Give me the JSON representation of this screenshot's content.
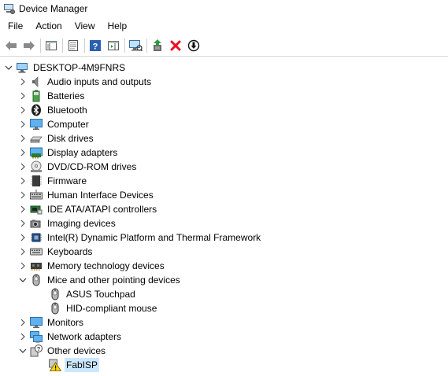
{
  "window": {
    "title": "Device Manager"
  },
  "menu": [
    "File",
    "Action",
    "View",
    "Help"
  ],
  "toolbar": {
    "buttons": [
      "back-arrow-icon",
      "forward-arrow-icon",
      "sep",
      "show-hide-tree-icon",
      "sep",
      "properties-icon",
      "sep",
      "help-icon",
      "action-pane-icon",
      "sep",
      "monitor-scan-icon",
      "sep",
      "update-driver-icon",
      "uninstall-icon",
      "disable-device-icon"
    ]
  },
  "tree": {
    "root": {
      "label": "DESKTOP-4M9FNRS",
      "expanded": true,
      "icon": "computer-root-icon"
    },
    "nodes": [
      {
        "label": "Audio inputs and outputs",
        "icon": "speaker-icon",
        "expanded": false
      },
      {
        "label": "Batteries",
        "icon": "battery-icon",
        "expanded": false
      },
      {
        "label": "Bluetooth",
        "icon": "bluetooth-icon",
        "expanded": false
      },
      {
        "label": "Computer",
        "icon": "monitor-icon",
        "expanded": false
      },
      {
        "label": "Disk drives",
        "icon": "disk-drive-icon",
        "expanded": false
      },
      {
        "label": "Display adapters",
        "icon": "display-adapter-icon",
        "expanded": false
      },
      {
        "label": "DVD/CD-ROM drives",
        "icon": "dvd-icon",
        "expanded": false
      },
      {
        "label": "Firmware",
        "icon": "firmware-icon",
        "expanded": false
      },
      {
        "label": "Human Interface Devices",
        "icon": "hid-icon",
        "expanded": false
      },
      {
        "label": "IDE ATA/ATAPI controllers",
        "icon": "ide-controller-icon",
        "expanded": false
      },
      {
        "label": "Imaging devices",
        "icon": "camera-icon",
        "expanded": false
      },
      {
        "label": "Intel(R) Dynamic Platform and Thermal Framework",
        "icon": "chip-icon",
        "expanded": false
      },
      {
        "label": "Keyboards",
        "icon": "keyboard-icon",
        "expanded": false
      },
      {
        "label": "Memory technology devices",
        "icon": "memory-icon",
        "expanded": false
      },
      {
        "label": "Mice and other pointing devices",
        "icon": "mouse-icon",
        "expanded": true,
        "children": [
          {
            "label": "ASUS Touchpad",
            "icon": "mouse-icon"
          },
          {
            "label": "HID-compliant mouse",
            "icon": "mouse-icon"
          }
        ]
      },
      {
        "label": "Monitors",
        "icon": "monitor-icon",
        "expanded": false
      },
      {
        "label": "Network adapters",
        "icon": "network-icon",
        "expanded": false
      },
      {
        "label": "Other devices",
        "icon": "unknown-device-icon",
        "expanded": true,
        "children": [
          {
            "label": "FabISP",
            "icon": "warning-device-icon",
            "selected": true
          }
        ]
      }
    ]
  },
  "colors": {
    "selection": "#cce8ff",
    "uninstall_red": "#e81123",
    "update_green": "#2e9b3a"
  }
}
